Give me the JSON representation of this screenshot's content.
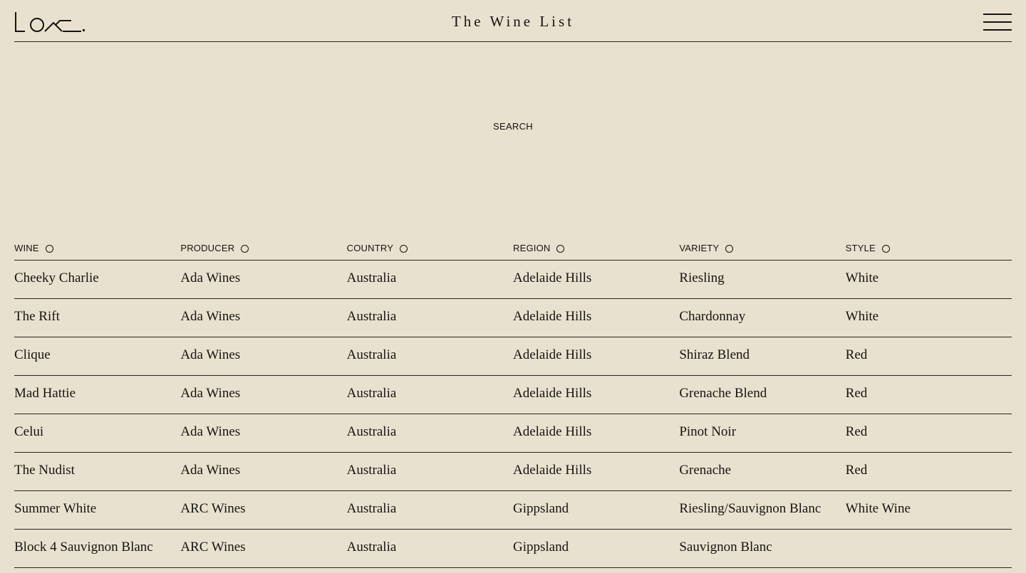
{
  "header": {
    "logo_alt": "Lo-fi logo",
    "title": "The Wine List",
    "menu_icon": "hamburger-icon"
  },
  "search": {
    "label": "SEARCH"
  },
  "table": {
    "columns": [
      "WINE",
      "PRODUCER",
      "COUNTRY",
      "REGION",
      "VARIETY",
      "STYLE"
    ],
    "sort_icon": "circle-icon",
    "rows": [
      [
        "Cheeky Charlie",
        "Ada Wines",
        "Australia",
        "Adelaide Hills",
        "Riesling",
        "White"
      ],
      [
        "The Rift",
        "Ada Wines",
        "Australia",
        "Adelaide Hills",
        "Chardonnay",
        "White"
      ],
      [
        "Clique",
        "Ada Wines",
        "Australia",
        "Adelaide Hills",
        "Shiraz Blend",
        "Red"
      ],
      [
        "Mad Hattie",
        "Ada Wines",
        "Australia",
        "Adelaide Hills",
        "Grenache Blend",
        "Red"
      ],
      [
        "Celui",
        "Ada Wines",
        "Australia",
        "Adelaide Hills",
        "Pinot Noir",
        "Red"
      ],
      [
        "The Nudist",
        "Ada Wines",
        "Australia",
        "Adelaide Hills",
        "Grenache",
        "Red"
      ],
      [
        "Summer White",
        "ARC Wines",
        "Australia",
        "Gippsland",
        "Riesling/Sauvignon Blanc",
        "White Wine"
      ],
      [
        "Block 4 Sauvignon Blanc",
        "ARC Wines",
        "Australia",
        "Gippsland",
        "Sauvignon Blanc",
        ""
      ]
    ]
  },
  "colors": {
    "background": "#e9e1cf",
    "text": "#161410"
  }
}
